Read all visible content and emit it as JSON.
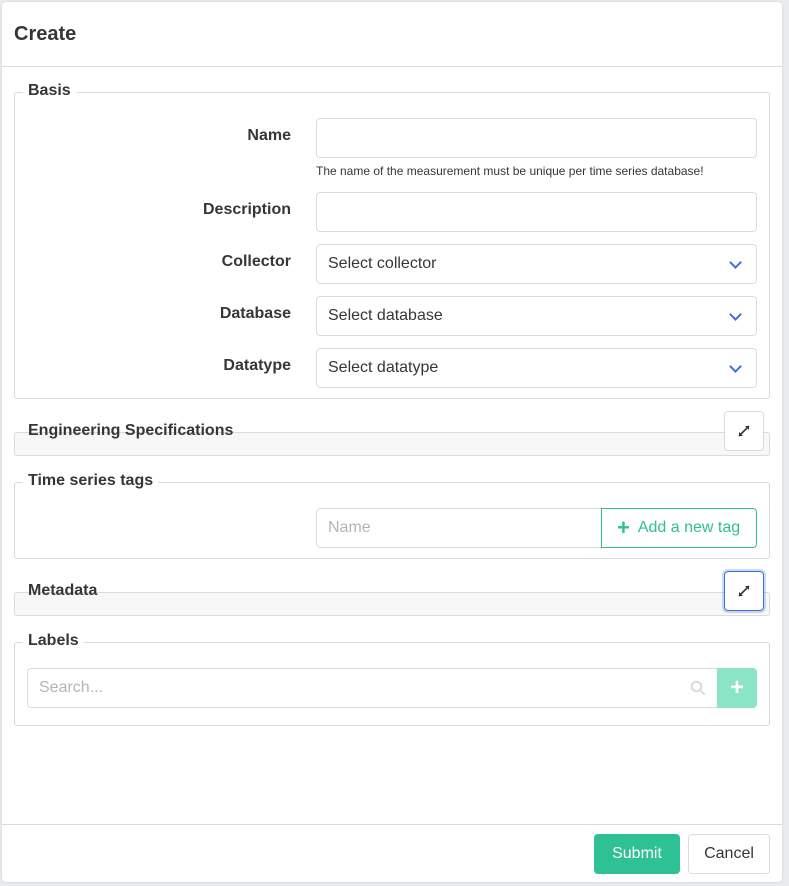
{
  "modal": {
    "title": "Create"
  },
  "basis": {
    "legend": "Basis",
    "name": {
      "label": "Name",
      "value": "",
      "help": "The name of the measurement must be unique per time series database!"
    },
    "description": {
      "label": "Description",
      "value": ""
    },
    "collector": {
      "label": "Collector",
      "selected": "Select collector"
    },
    "database": {
      "label": "Database",
      "selected": "Select database"
    },
    "datatype": {
      "label": "Datatype",
      "selected": "Select datatype"
    }
  },
  "engineering": {
    "legend": "Engineering Specifications",
    "icon": "expand-icon"
  },
  "tags": {
    "legend": "Time series tags",
    "name_placeholder": "Name",
    "add_label": "Add a new tag"
  },
  "metadata": {
    "legend": "Metadata",
    "icon": "expand-icon"
  },
  "labels": {
    "legend": "Labels",
    "search_placeholder": "Search...",
    "add_icon": "plus-icon"
  },
  "footer": {
    "submit_label": "Submit",
    "cancel_label": "Cancel"
  },
  "colors": {
    "primary": "#2ec193",
    "primary_light": "#8ce4c6",
    "link": "#3e6fd8",
    "border": "#dbdbdb"
  }
}
